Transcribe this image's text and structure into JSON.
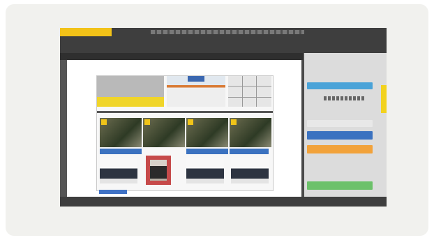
{
  "colors": {
    "accent_yellow": "#f2c218",
    "accent_blue": "#3b72c0",
    "accent_orange": "#f2a23a",
    "accent_green": "#6cc16a",
    "panel_bg": "#dcdcdc",
    "window_bg": "#3e3e3e"
  },
  "panel": {
    "chips": [
      {
        "name": "panel-chip-top-blue",
        "color": "#4aa3d8"
      },
      {
        "name": "panel-chip-light",
        "color": "#e8e8e8"
      },
      {
        "name": "panel-chip-blue",
        "color": "#3b72c0"
      },
      {
        "name": "panel-chip-orange",
        "color": "#f2a23a"
      },
      {
        "name": "panel-chip-green",
        "color": "#6cc16a"
      }
    ]
  }
}
